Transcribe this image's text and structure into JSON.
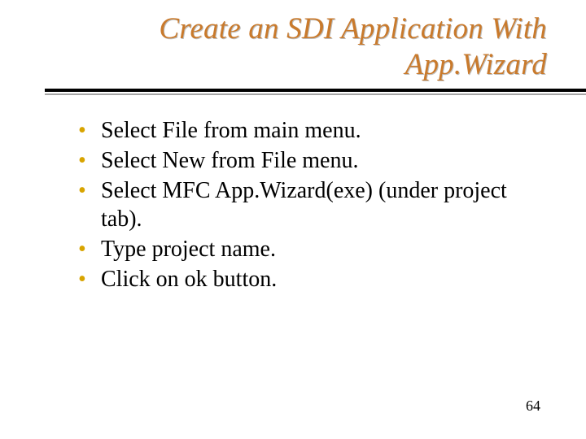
{
  "title_line1": "Create an SDI Application With",
  "title_line2": "App.Wizard",
  "bullets": [
    "Select File from main menu.",
    "Select New from File menu.",
    "Select MFC App.Wizard(exe) (under project tab).",
    "Type project name.",
    "Click on ok button."
  ],
  "page_number": "64"
}
